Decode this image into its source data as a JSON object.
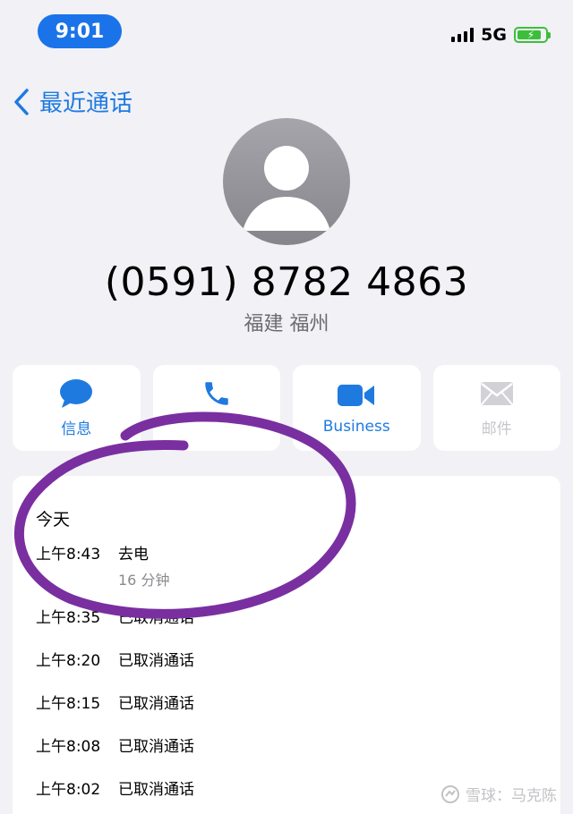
{
  "status_bar": {
    "time": "9:01",
    "network": "5G",
    "battery_charge": 0.75
  },
  "nav": {
    "back_label": "最近通话"
  },
  "contact": {
    "phone_number": "(0591) 8782 4863",
    "location": "福建 福州"
  },
  "actions": [
    {
      "label": "信息",
      "icon": "message-bubble-icon",
      "enabled": true
    },
    {
      "label": "",
      "icon": "phone-icon",
      "enabled": true
    },
    {
      "label": "Business",
      "icon": "video-icon",
      "enabled": true
    },
    {
      "label": "邮件",
      "icon": "mail-icon",
      "enabled": false
    }
  ],
  "history": {
    "day_label": "今天",
    "calls": [
      {
        "time": "上午8:43",
        "status": "去电",
        "duration": "16 分钟"
      },
      {
        "time": "上午8:35",
        "status": "已取消通话"
      },
      {
        "time": "上午8:20",
        "status": "已取消通话"
      },
      {
        "time": "上午8:15",
        "status": "已取消通话"
      },
      {
        "time": "上午8:08",
        "status": "已取消通话"
      },
      {
        "time": "上午8:02",
        "status": "已取消通话"
      }
    ]
  },
  "watermark": "雪球：马克陈",
  "colors": {
    "accent": "#1f7ae0",
    "annotation": "#7a2fa0",
    "background": "#f1f1f6"
  }
}
